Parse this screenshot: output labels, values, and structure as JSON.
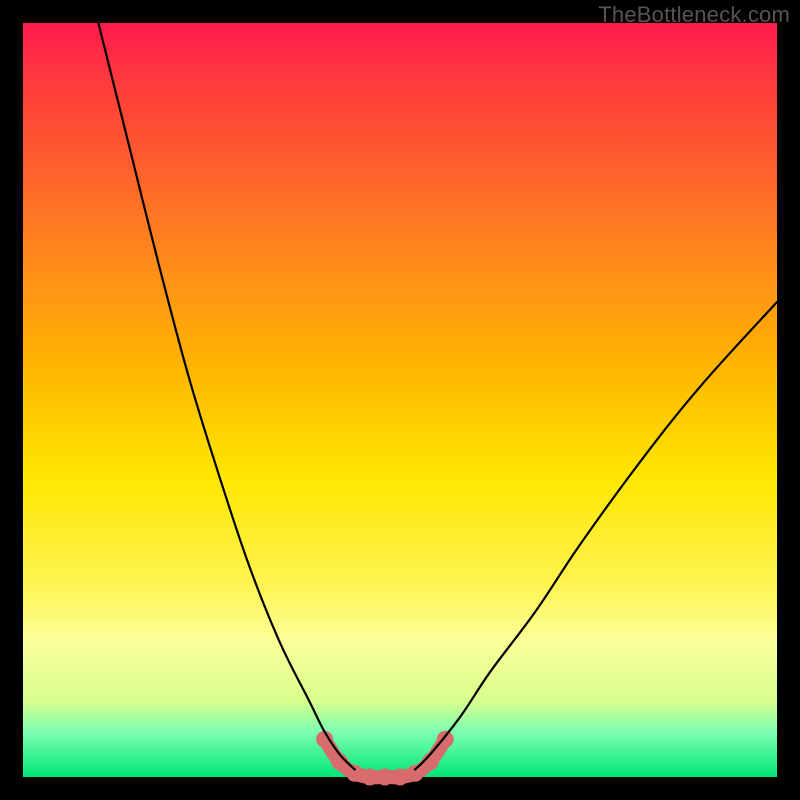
{
  "watermark": "TheBottleneck.com",
  "colors": {
    "gradient_top": "#ff1a4d",
    "gradient_bottom": "#00e676",
    "curve": "#000000",
    "valley_highlight": "#d86b6b",
    "background": "#000000"
  },
  "chart_data": {
    "type": "line",
    "title": "",
    "xlabel": "",
    "ylabel": "",
    "xlim": [
      0,
      100
    ],
    "ylim": [
      0,
      100
    ],
    "series": [
      {
        "name": "left-curve",
        "x": [
          10,
          14,
          18,
          22,
          26,
          30,
          34,
          38,
          40,
          42,
          44
        ],
        "y": [
          100,
          84,
          68,
          53,
          40,
          28,
          18,
          10,
          6,
          3,
          1
        ]
      },
      {
        "name": "right-curve",
        "x": [
          52,
          54,
          58,
          62,
          68,
          74,
          82,
          90,
          100
        ],
        "y": [
          1,
          3,
          8,
          14,
          22,
          31,
          42,
          52,
          63
        ]
      },
      {
        "name": "valley-floor-highlight",
        "x": [
          40,
          42,
          44,
          46,
          48,
          50,
          52,
          54,
          56
        ],
        "y": [
          5,
          2,
          0.5,
          0,
          0,
          0,
          0.5,
          2,
          5
        ]
      }
    ],
    "annotations": [
      {
        "text": "TheBottleneck.com",
        "position": "top-right"
      }
    ]
  }
}
